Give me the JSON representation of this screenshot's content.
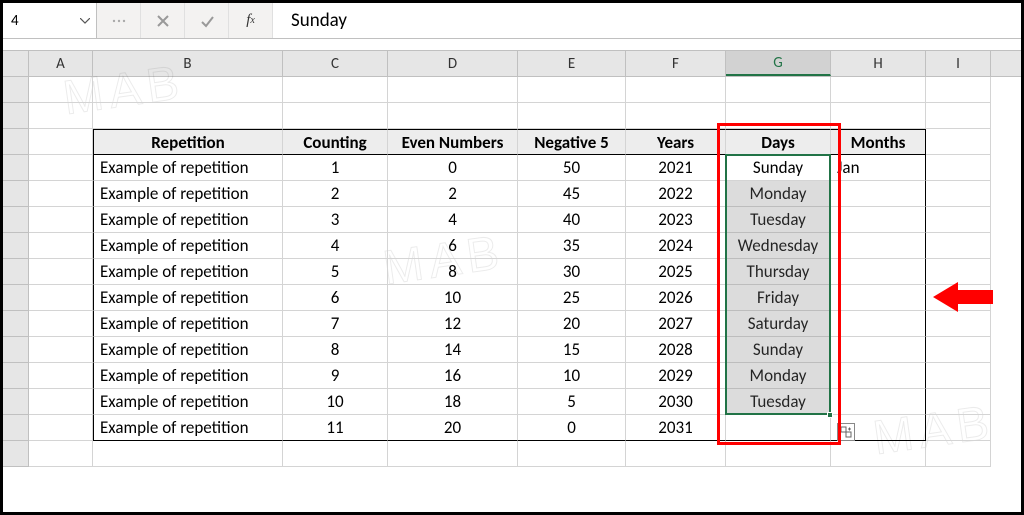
{
  "name_box": "4",
  "formula_value": "Sunday",
  "columns": [
    "A",
    "B",
    "C",
    "D",
    "E",
    "F",
    "G",
    "H",
    "I"
  ],
  "selected_column": "G",
  "table": {
    "headers": [
      "Repetition",
      "Counting",
      "Even Numbers",
      "Negative 5",
      "Years",
      "Days",
      "Months"
    ],
    "rows": [
      [
        "Example of repetition",
        1,
        0,
        50,
        2021,
        "Sunday",
        "Jan"
      ],
      [
        "Example of repetition",
        2,
        2,
        45,
        2022,
        "Monday",
        ""
      ],
      [
        "Example of repetition",
        3,
        4,
        40,
        2023,
        "Tuesday",
        ""
      ],
      [
        "Example of repetition",
        4,
        6,
        35,
        2024,
        "Wednesday",
        ""
      ],
      [
        "Example of repetition",
        5,
        8,
        30,
        2025,
        "Thursday",
        ""
      ],
      [
        "Example of repetition",
        6,
        10,
        25,
        2026,
        "Friday",
        ""
      ],
      [
        "Example of repetition",
        7,
        12,
        20,
        2027,
        "Saturday",
        ""
      ],
      [
        "Example of repetition",
        8,
        14,
        15,
        2028,
        "Sunday",
        ""
      ],
      [
        "Example of repetition",
        9,
        16,
        10,
        2029,
        "Monday",
        ""
      ],
      [
        "Example of repetition",
        10,
        18,
        5,
        2030,
        "Tuesday",
        ""
      ],
      [
        "Example of repetition",
        11,
        20,
        0,
        2031,
        "",
        ""
      ]
    ]
  },
  "watermark": "MAB"
}
